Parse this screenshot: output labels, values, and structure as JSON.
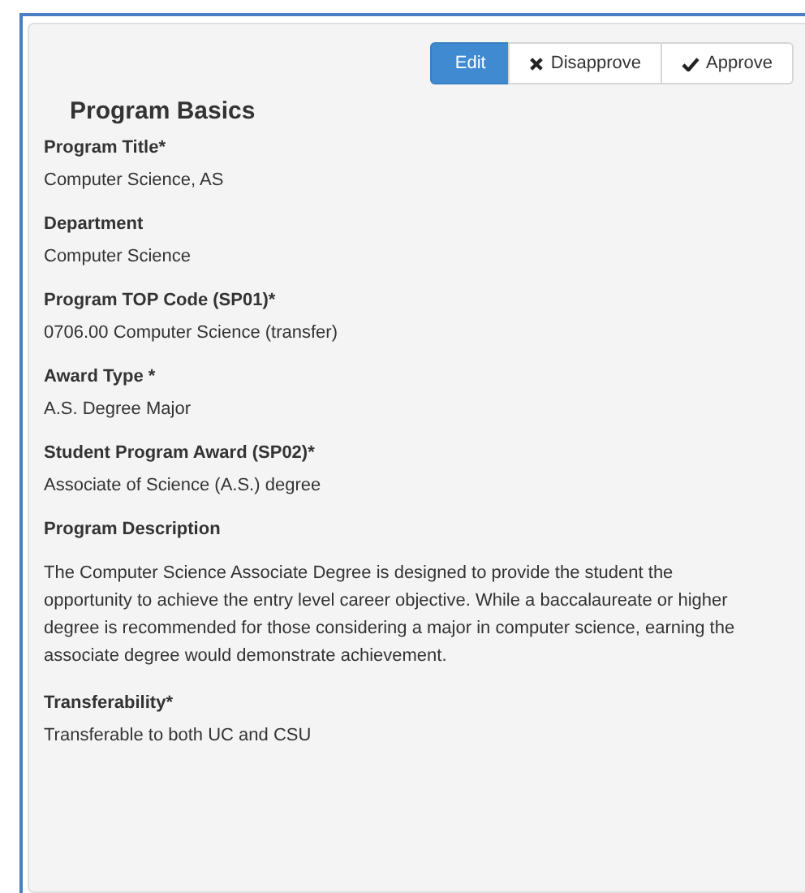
{
  "buttons": [
    {
      "label": "Edit",
      "kind": "primary"
    },
    {
      "label": "Disapprove",
      "kind": "reject"
    },
    {
      "label": "Approve",
      "kind": "approve"
    }
  ],
  "heading": "Program Basics",
  "fields": [
    {
      "label": "Program Title*",
      "value": "Computer Science, AS",
      "kind": "line"
    },
    {
      "label": "Department",
      "value": "Computer Science",
      "kind": "line"
    },
    {
      "label": "Program TOP Code (SP01)*",
      "value": "0706.00 Computer Science (transfer)",
      "kind": "line"
    },
    {
      "label": "Award Type *",
      "value": "A.S. Degree Major",
      "kind": "line"
    },
    {
      "label": "Student Program Award (SP02)*",
      "value": "Associate of Science (A.S.) degree",
      "kind": "line"
    },
    {
      "label": "Program Description",
      "value": "The Computer Science Associate Degree is designed to provide the student the opportunity to achieve the entry level career objective. While a baccalaureate or higher degree is recommended for those considering a major in computer science, earning the associate degree would demonstrate achievement.",
      "kind": "paragraph"
    },
    {
      "label": "Transferability*",
      "value": "Transferable to both UC and CSU",
      "kind": "line"
    }
  ]
}
